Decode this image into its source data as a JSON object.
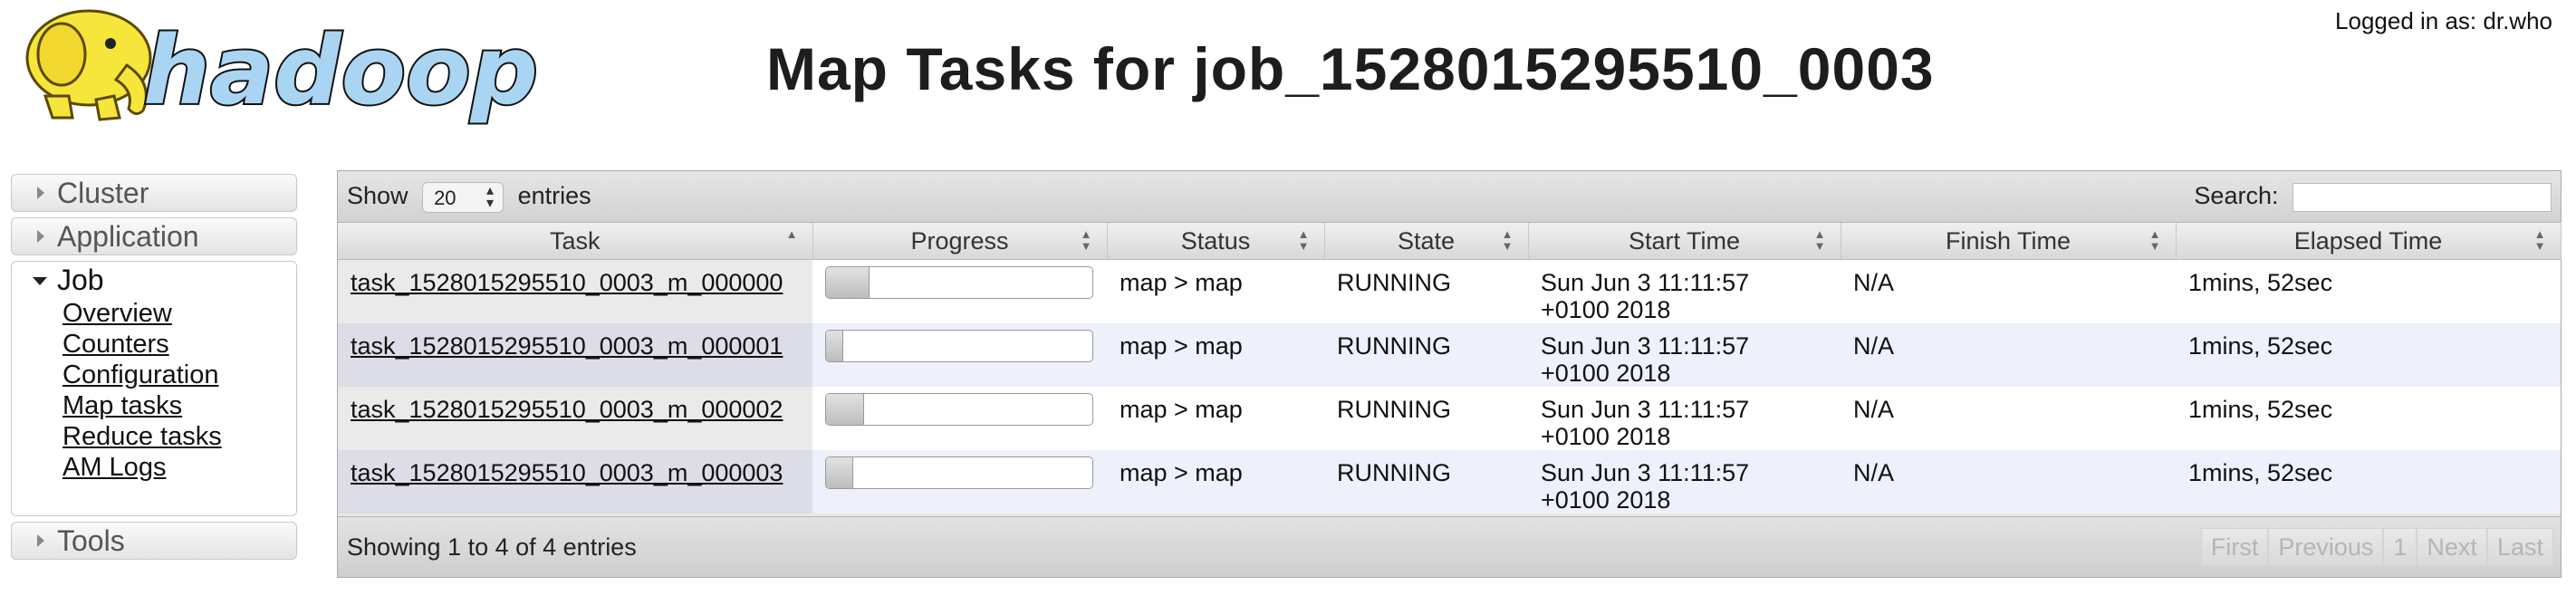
{
  "header": {
    "logo_text": "hadoop",
    "title": "Map Tasks for job_1528015295510_0003",
    "logged_in": "Logged in as: dr.who"
  },
  "sidebar": {
    "cluster": "Cluster",
    "application": "Application",
    "job": "Job",
    "job_items": [
      "Overview",
      "Counters",
      "Configuration",
      "Map tasks",
      "Reduce tasks",
      "AM Logs"
    ],
    "tools": "Tools"
  },
  "table": {
    "show_label": "Show",
    "entries_value": "20",
    "entries_label": "entries",
    "search_label": "Search:",
    "columns": [
      "Task",
      "Progress",
      "Status",
      "State",
      "Start Time",
      "Finish Time",
      "Elapsed Time"
    ],
    "rows": [
      {
        "task": "task_1528015295510_0003_m_000000",
        "progress": 0.16,
        "status": "map > map",
        "state": "RUNNING",
        "start_line1": "Sun Jun 3 11:11:57",
        "start_line2": "+0100 2018",
        "finish": "N/A",
        "elapsed": "1mins, 52sec"
      },
      {
        "task": "task_1528015295510_0003_m_000001",
        "progress": 0.06,
        "status": "map > map",
        "state": "RUNNING",
        "start_line1": "Sun Jun 3 11:11:57",
        "start_line2": "+0100 2018",
        "finish": "N/A",
        "elapsed": "1mins, 52sec"
      },
      {
        "task": "task_1528015295510_0003_m_000002",
        "progress": 0.14,
        "status": "map > map",
        "state": "RUNNING",
        "start_line1": "Sun Jun 3 11:11:57",
        "start_line2": "+0100 2018",
        "finish": "N/A",
        "elapsed": "1mins, 52sec"
      },
      {
        "task": "task_1528015295510_0003_m_000003",
        "progress": 0.1,
        "status": "map > map",
        "state": "RUNNING",
        "start_line1": "Sun Jun 3 11:11:57",
        "start_line2": "+0100 2018",
        "finish": "N/A",
        "elapsed": "1mins, 52sec"
      }
    ],
    "info": "Showing 1 to 4 of 4 entries",
    "pager": [
      "First",
      "Previous",
      "1",
      "Next",
      "Last"
    ]
  },
  "colors": {
    "row_even": "#eef0fb",
    "logo_blue": "#a8d4f0",
    "elephant_yellow": "#f5e23a"
  },
  "icons": [
    "hadoop-elephant-logo",
    "triangle-right-icon",
    "triangle-down-icon",
    "sort-icon"
  ]
}
